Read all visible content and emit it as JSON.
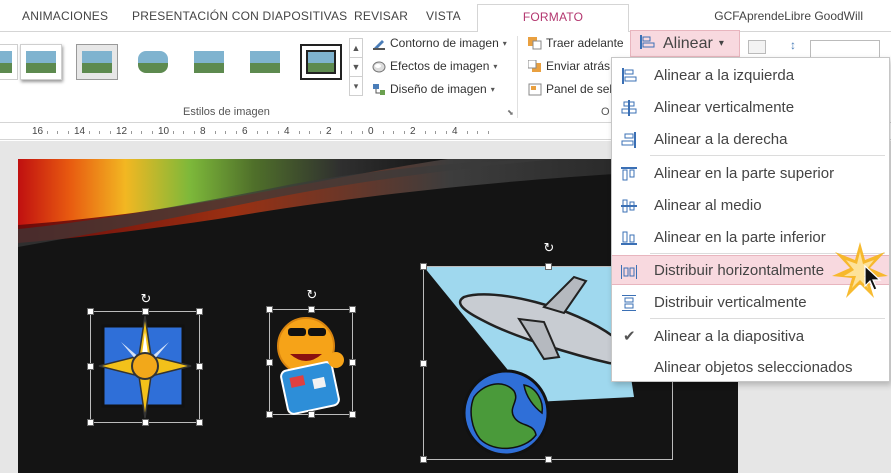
{
  "tabs": {
    "animaciones": "ANIMACIONES",
    "presentacion": "PRESENTACIÓN CON DIAPOSITIVAS",
    "revisar": "REVISAR",
    "vista": "VISTA",
    "formato": "FORMATO"
  },
  "user": "GCFAprendeLibre GoodWill",
  "ribbon": {
    "picture_styles_label": "Estilos de imagen",
    "contorno": "Contorno de imagen",
    "efectos": "Efectos de imagen",
    "diseno": "Diseño de imagen",
    "traer": "Traer adelante",
    "enviar": "Enviar atrás",
    "panel": "Panel de sele",
    "ordenar_label": "O",
    "alinear": "Alinear"
  },
  "ruler": {
    "numbers": [
      "16",
      "14",
      "12",
      "10",
      "8",
      "6",
      "4",
      "2",
      "0",
      "2",
      "4"
    ]
  },
  "align_menu": {
    "items": [
      "Alinear a la izquierda",
      "Alinear verticalmente",
      "Alinear a la derecha",
      "Alinear en la parte superior",
      "Alinear al medio",
      "Alinear en la parte inferior",
      "Distribuir horizontalmente",
      "Distribuir verticalmente",
      "Alinear a la diapositiva",
      "Alinear objetos seleccionados"
    ],
    "highlighted_index": 6,
    "checked_index": 8
  },
  "colors": {
    "accent_tab": "#b3366f",
    "highlight": "#f8d9df",
    "slide_bg": "#141414"
  }
}
